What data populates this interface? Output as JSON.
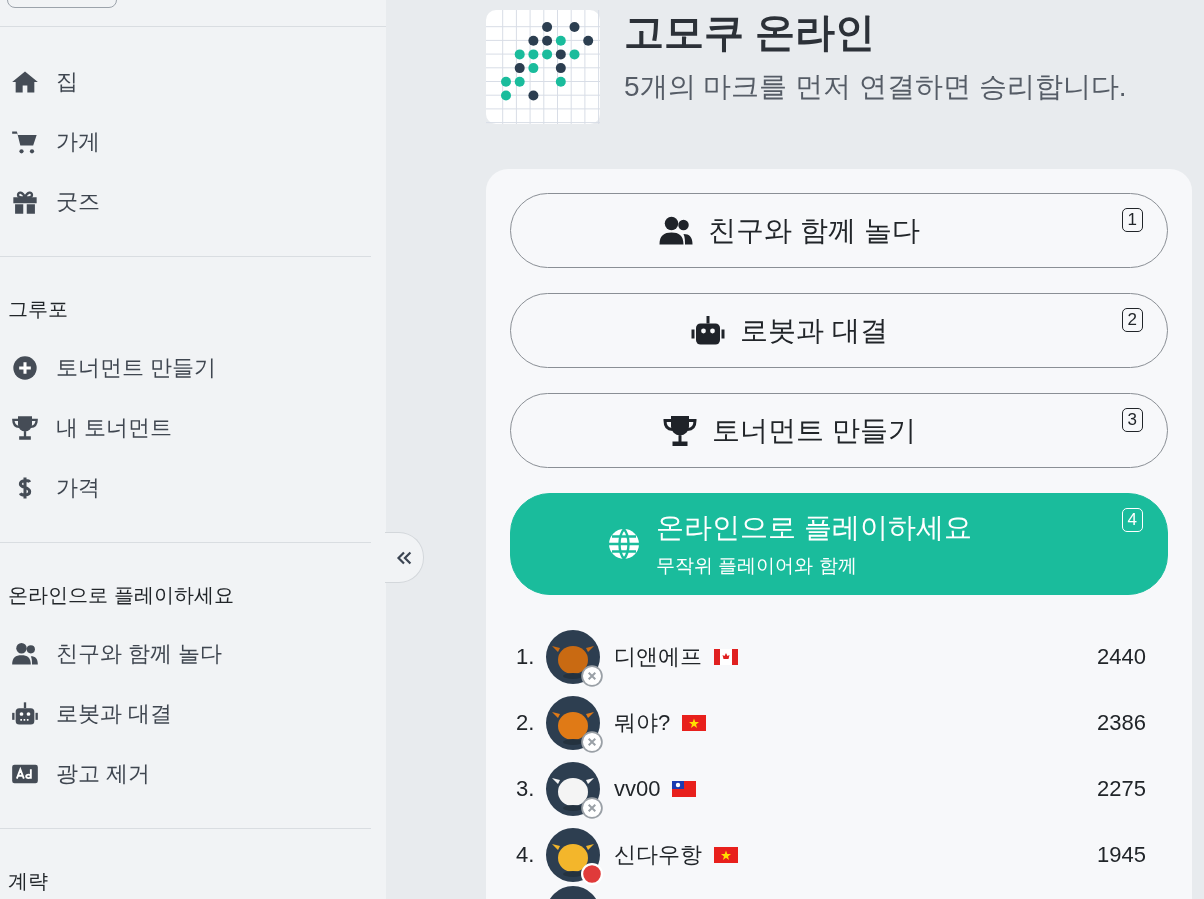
{
  "sidebar": {
    "sections": [
      {
        "items": [
          {
            "label": "집"
          },
          {
            "label": "가게"
          },
          {
            "label": "굿즈"
          }
        ]
      },
      {
        "heading": "그루포",
        "items": [
          {
            "label": "토너먼트 만들기"
          },
          {
            "label": "내 토너먼트"
          },
          {
            "label": "가격"
          }
        ]
      },
      {
        "heading": "온라인으로 플레이하세요",
        "items": [
          {
            "label": "친구와 함께 놀다"
          },
          {
            "label": "로봇과 대결"
          },
          {
            "label": "광고 제거"
          }
        ]
      },
      {
        "heading": "계략"
      }
    ]
  },
  "header": {
    "title": "고모쿠 온라인",
    "subtitle": "5개의 마크를 먼저 연결하면 승리합니다."
  },
  "play_options": [
    {
      "kind": "outline",
      "label": "친구와 함께 놀다",
      "key": "1"
    },
    {
      "kind": "outline",
      "label": "로봇과 대결",
      "key": "2"
    },
    {
      "kind": "outline",
      "label": "토너먼트 만들기",
      "key": "3"
    },
    {
      "kind": "primary",
      "label": "온라인으로 플레이하세요",
      "sublabel": "무작위 플레이어와 함께",
      "key": "4"
    }
  ],
  "leaderboard": [
    {
      "rank": "1.",
      "name": "디앤에프",
      "flag": {
        "kind": "ca"
      },
      "rating": "2440",
      "in_game": false
    },
    {
      "rank": "2.",
      "name": "뭐야?",
      "flag": {
        "kind": "vn"
      },
      "rating": "2386",
      "in_game": false
    },
    {
      "rank": "3.",
      "name": "vv00",
      "flag": {
        "kind": "tw"
      },
      "rating": "2275",
      "in_game": false
    },
    {
      "rank": "4.",
      "name": "신다우항",
      "flag": {
        "kind": "vn"
      },
      "rating": "1945",
      "in_game": true
    },
    {
      "kind": "picture"
    }
  ]
}
